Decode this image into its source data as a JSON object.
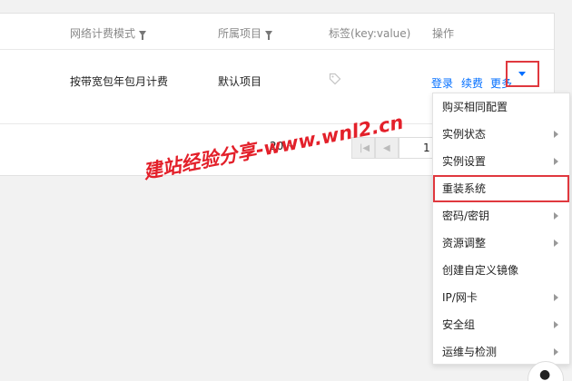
{
  "table": {
    "headers": [
      {
        "label": "网络计费模式",
        "filter": true
      },
      {
        "label": "所属项目",
        "filter": true
      },
      {
        "label": "标签(key:value)",
        "filter": false
      },
      {
        "label": "操作",
        "filter": false
      }
    ],
    "row": {
      "billing_mode": "按带宽包年包月计费",
      "project": "默认项目",
      "tag_icon": "tag-icon",
      "actions": {
        "login": "登录",
        "renew": "续费",
        "more": "更多"
      }
    }
  },
  "pagination": {
    "page_size": "20",
    "current_page": "1"
  },
  "more_menu": {
    "items": [
      {
        "label": "购买相同配置",
        "submenu": false,
        "highlighted": false
      },
      {
        "label": "实例状态",
        "submenu": true,
        "highlighted": false
      },
      {
        "label": "实例设置",
        "submenu": true,
        "highlighted": false
      },
      {
        "label": "重装系统",
        "submenu": false,
        "highlighted": true
      },
      {
        "label": "密码/密钥",
        "submenu": true,
        "highlighted": false
      },
      {
        "label": "资源调整",
        "submenu": true,
        "highlighted": false
      },
      {
        "label": "创建自定义镜像",
        "submenu": false,
        "highlighted": false
      },
      {
        "label": "IP/网卡",
        "submenu": true,
        "highlighted": false
      },
      {
        "label": "安全组",
        "submenu": true,
        "highlighted": false
      },
      {
        "label": "运维与检测",
        "submenu": true,
        "highlighted": false
      }
    ]
  },
  "watermark": "建站经验分享-www.wnl2.cn",
  "colors": {
    "link": "#006eff",
    "highlight_border": "#e0383e",
    "watermark": "#e3202a"
  }
}
